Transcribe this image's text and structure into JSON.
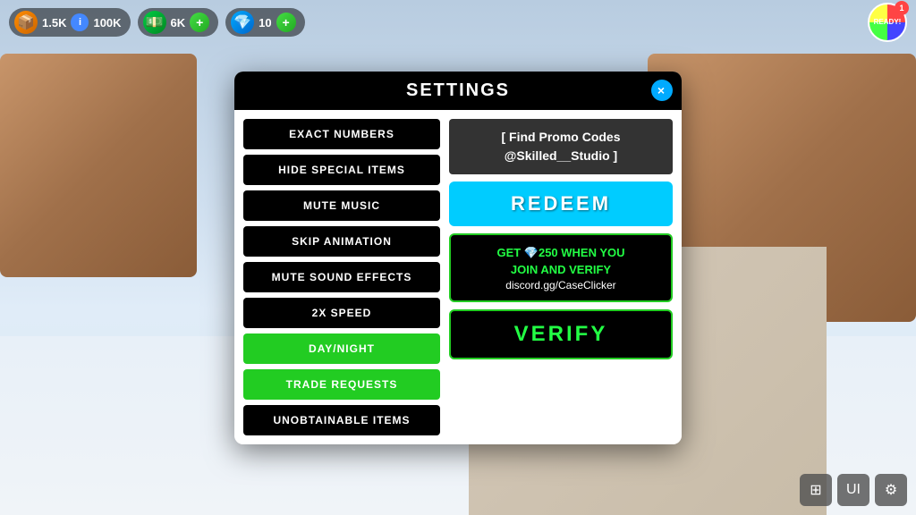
{
  "background": {
    "color": "#c8d8e8"
  },
  "hud": {
    "currency1": {
      "icon": "📦",
      "value": "1.5K",
      "max": "100K"
    },
    "currency2": {
      "icon": "💵",
      "value": "6K"
    },
    "currency3": {
      "icon": "💎",
      "value": "10"
    },
    "avatar_badge": "1",
    "ready_label": "READY!"
  },
  "modal": {
    "title": "SETTINGS",
    "close_label": "×",
    "buttons": [
      {
        "label": "EXACT NUMBERS",
        "style": "black"
      },
      {
        "label": "HIDE SPECIAL ITEMS",
        "style": "black"
      },
      {
        "label": "MUTE MUSIC",
        "style": "black"
      },
      {
        "label": "SKIP ANIMATION",
        "style": "black"
      },
      {
        "label": "MUTE SOUND EFFECTS",
        "style": "black"
      },
      {
        "label": "2X SPEED",
        "style": "black"
      },
      {
        "label": "DAY/NIGHT",
        "style": "green"
      },
      {
        "label": "TRADE REQUESTS",
        "style": "green"
      },
      {
        "label": "UNOBTAINABLE ITEMS",
        "style": "black"
      }
    ],
    "promo_line1": "[ Find Promo Codes",
    "promo_line2": "@Skilled__Studio ]",
    "redeem_label": "REDEEM",
    "discord": {
      "line1": "GET 💎250 WHEN YOU",
      "line2": "JOIN AND VERIFY",
      "link": "discord.gg/CaseClicker"
    },
    "verify_label": "VERIFY"
  },
  "bottom_icons": {
    "icon1": "⊞",
    "icon2": "UI",
    "icon3": "⚙"
  }
}
